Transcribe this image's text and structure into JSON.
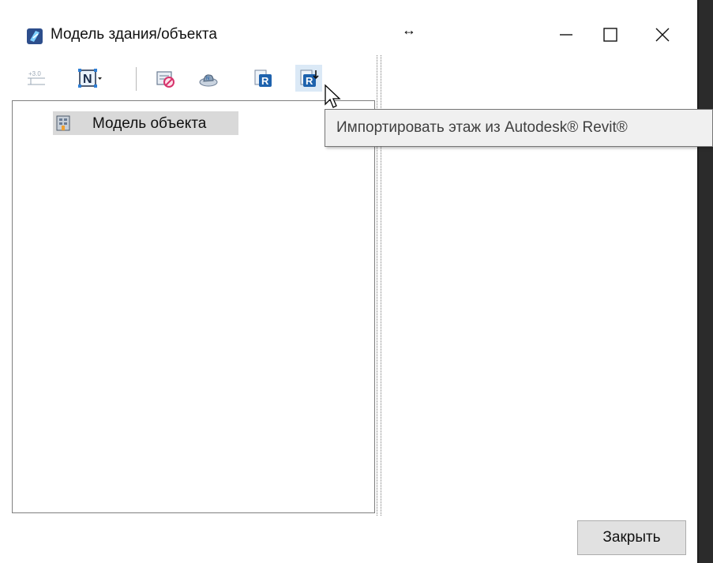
{
  "window": {
    "title": "Модель здания/объекта"
  },
  "toolbar": {
    "buttons": [
      {
        "icon": "elevation-icon",
        "tooltip": ""
      },
      {
        "icon": "north-arrow-icon",
        "tooltip": ""
      },
      {
        "icon": "prohibit-layer-icon",
        "tooltip": ""
      },
      {
        "icon": "cloud-model-icon",
        "tooltip": ""
      },
      {
        "icon": "revit-icon",
        "tooltip": ""
      },
      {
        "icon": "revit-import-floor-icon",
        "tooltip": "Импортировать этаж из Autodesk® Revit®"
      }
    ]
  },
  "tree": {
    "items": [
      {
        "label": "Модель объекта",
        "icon": "building-icon"
      }
    ]
  },
  "tooltip": {
    "text": "Импортировать этаж из Autodesk® Revit®"
  },
  "footer": {
    "close_label": "Закрыть"
  },
  "colors": {
    "accent": "#1b6ec2",
    "revit_blue": "#1e62ad",
    "selected_bg": "#d9d9d9",
    "tooltip_bg": "#f0f0f0"
  }
}
